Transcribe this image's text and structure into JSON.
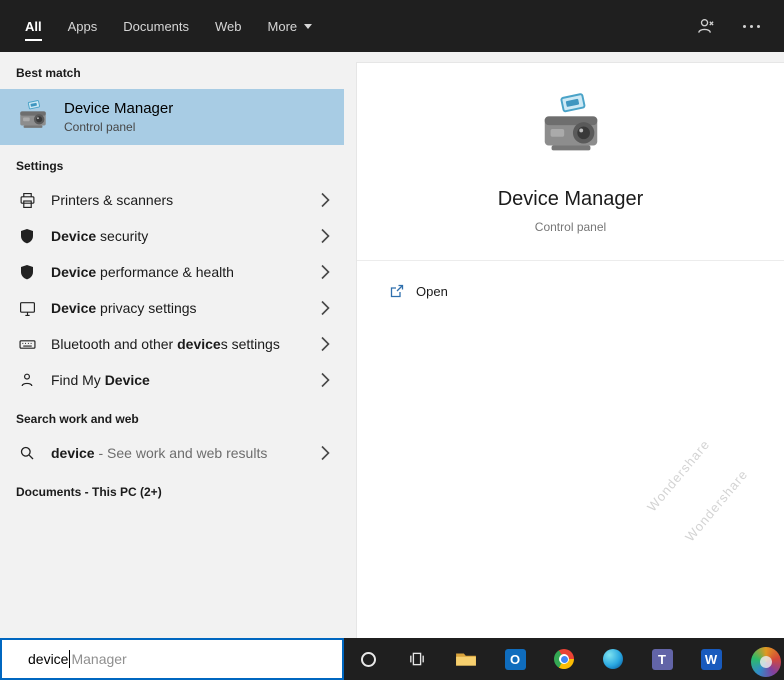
{
  "colors": {
    "accent": "#0067c0",
    "best_match_highlight": "#a8cce4",
    "header_bg": "#1f1f1f",
    "taskbar_bg": "#1f1f1f"
  },
  "header": {
    "tabs": [
      {
        "label": "All"
      },
      {
        "label": "Apps"
      },
      {
        "label": "Documents"
      },
      {
        "label": "Web"
      },
      {
        "label": "More"
      }
    ]
  },
  "left": {
    "best_match_header": "Best match",
    "best_match_title": "Device Manager",
    "best_match_subtitle": "Control panel",
    "settings_header": "Settings",
    "settings_items": [
      {
        "pre": "Printers & scanners",
        "bold": "",
        "post": "",
        "icon": "printer-icon"
      },
      {
        "pre": "",
        "bold": "Device",
        "post": " security",
        "icon": "shield-icon"
      },
      {
        "pre": "",
        "bold": "Device",
        "post": " performance & health",
        "icon": "shield-icon"
      },
      {
        "pre": "",
        "bold": "Device",
        "post": " privacy settings",
        "icon": "monitor-icon"
      },
      {
        "pre": "Bluetooth and other ",
        "bold": "device",
        "post": "s settings",
        "icon": "keyboard-icon"
      },
      {
        "pre": "Find My ",
        "bold": "Device",
        "post": "",
        "icon": "person-icon"
      }
    ],
    "search_header": "Search work and web",
    "web_result_bold": "device",
    "web_result_rest": " - See work and web results",
    "documents_header": "Documents - This PC (2+)"
  },
  "main": {
    "title": "Device Manager",
    "subtitle": "Control panel",
    "open_label": "Open"
  },
  "search": {
    "typed": "device",
    "suggestion": "Manager"
  },
  "taskbar": {
    "icons": [
      "cortana",
      "task-view",
      "file-explorer",
      "outlook",
      "chrome",
      "edge",
      "teams",
      "word"
    ],
    "outlook_glyph": "O",
    "teams_glyph": "T",
    "word_glyph": "W"
  },
  "watermark": {
    "text": "Wondershare"
  }
}
